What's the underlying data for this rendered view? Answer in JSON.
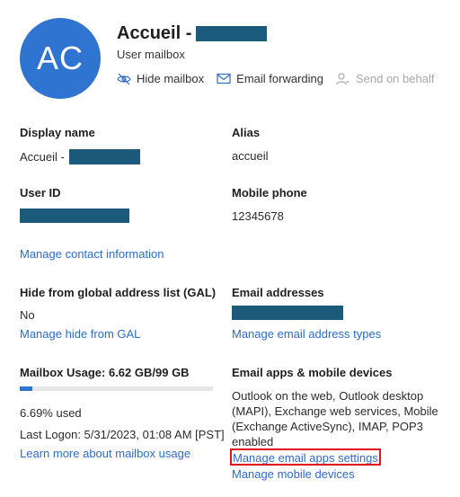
{
  "user": {
    "initials": "AC",
    "name_prefix": "Accueil -",
    "type": "User mailbox"
  },
  "actions": {
    "hide_mailbox": "Hide mailbox",
    "email_forwarding": "Email forwarding",
    "send_on_behalf": "Send on behalf"
  },
  "fields": {
    "display_name_label": "Display name",
    "display_name_prefix": "Accueil -",
    "alias_label": "Alias",
    "alias_value": "accueil",
    "user_id_label": "User ID",
    "mobile_label": "Mobile phone",
    "mobile_value": "12345678",
    "manage_contact": "Manage contact information",
    "gal_label": "Hide from global address list (GAL)",
    "gal_value": "No",
    "manage_gal": "Manage hide from GAL",
    "email_addresses_label": "Email addresses",
    "manage_email_types": "Manage email address types",
    "mailbox_usage_label": "Mailbox Usage: 6.62 GB/99 GB",
    "usage_fraction": 0.0669,
    "usage_percent": "6.69% used",
    "last_logon": "Last Logon: 5/31/2023, 01:08 AM [PST]",
    "learn_more": "Learn more about mailbox usage",
    "email_apps_label": "Email apps & mobile devices",
    "email_apps_desc": "Outlook on the web, Outlook desktop (MAPI), Exchange web services, Mobile (Exchange ActiveSync), IMAP, POP3 enabled",
    "manage_email_apps": "Manage email apps settings",
    "manage_mobile": "Manage mobile devices"
  },
  "colors": {
    "accent": "#2f74d0",
    "link": "#2e6cc7",
    "redaction": "#1b5a7a",
    "highlight": "#e2121c"
  }
}
